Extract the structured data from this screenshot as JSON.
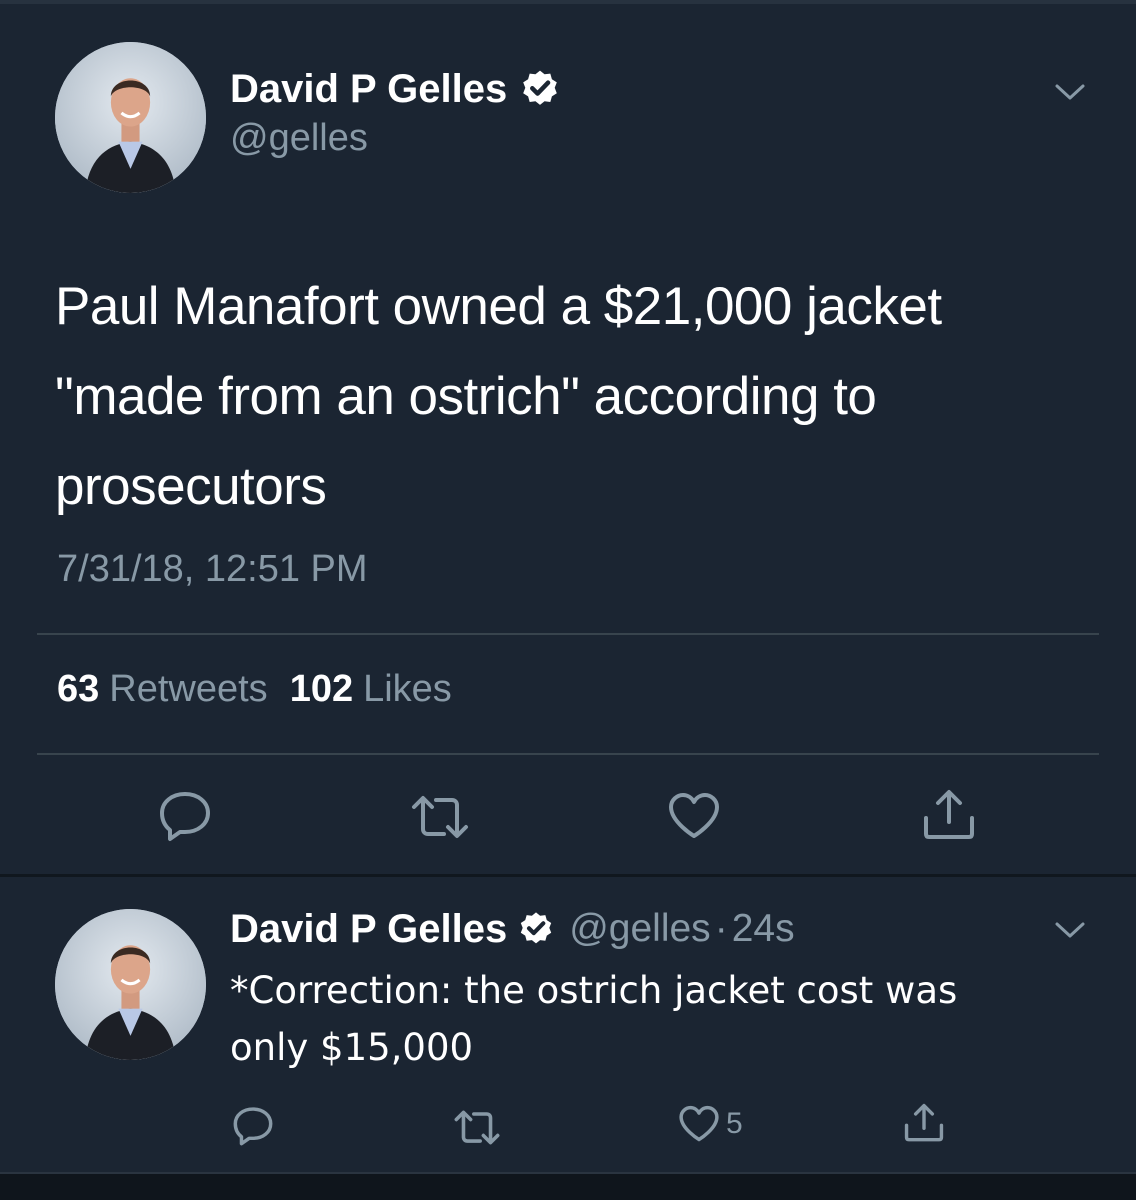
{
  "main_tweet": {
    "author": {
      "display_name": "David P Gelles",
      "handle": "@gelles",
      "verified": true,
      "avatar_icon": "profile-photo"
    },
    "text_lines": [
      "Paul Manafort owned a $21,000 jacket",
      "\"made from an ostrich\" according to",
      "prosecutors"
    ],
    "timestamp": "7/31/18, 12:51 PM",
    "stats": {
      "retweets_count": "63",
      "retweets_label": "Retweets",
      "likes_count": "102",
      "likes_label": "Likes"
    },
    "actions": [
      "reply-icon",
      "retweet-icon",
      "like-icon",
      "share-icon"
    ]
  },
  "reply_tweet": {
    "author": {
      "display_name": "David P Gelles",
      "handle": "@gelles",
      "separator": "·",
      "time": "24s",
      "verified": true,
      "avatar_icon": "profile-photo"
    },
    "text_lines": [
      "*Correction: the ostrich jacket cost was",
      "only $15,000"
    ],
    "like_count": "5",
    "actions": [
      "reply-icon",
      "retweet-icon",
      "like-icon",
      "share-icon"
    ]
  },
  "colors": {
    "background": "#1b2532",
    "primary_text": "#ffffff",
    "secondary_text": "#8899a6",
    "divider": "#38444d"
  }
}
